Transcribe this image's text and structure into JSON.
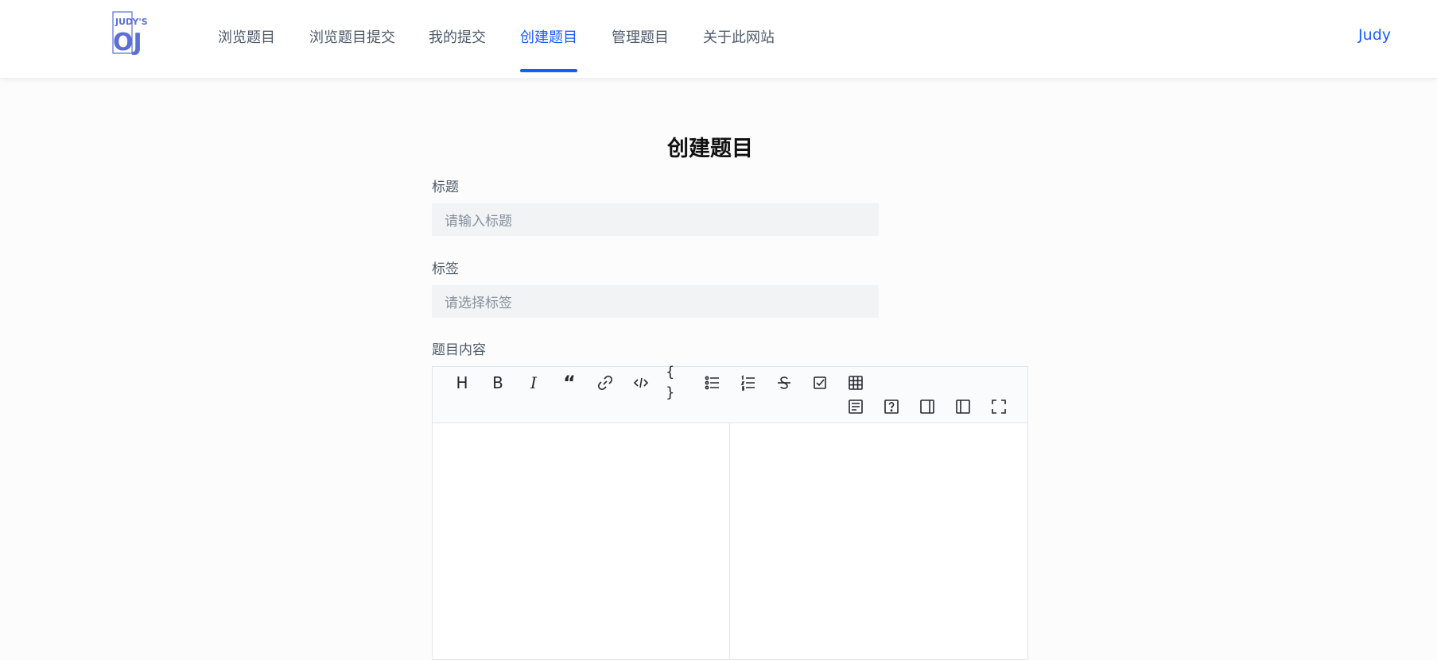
{
  "header": {
    "logo_text_top": "JUDY'S",
    "logo_text_main": "OJ",
    "nav": [
      {
        "label": "浏览题目",
        "active": false
      },
      {
        "label": "浏览题目提交",
        "active": false
      },
      {
        "label": "我的提交",
        "active": false
      },
      {
        "label": "创建题目",
        "active": true
      },
      {
        "label": "管理题目",
        "active": false
      },
      {
        "label": "关于此网站",
        "active": false
      }
    ],
    "user": "Judy"
  },
  "form": {
    "title": "创建题目",
    "title_label": "标题",
    "title_placeholder": "请输入标题",
    "tags_label": "标签",
    "tags_placeholder": "请选择标签",
    "content_label": "题目内容"
  },
  "editor": {
    "toolbar_row1": [
      "heading-icon",
      "bold-icon",
      "italic-icon",
      "quote-icon",
      "link-icon",
      "code-icon",
      "code-block-icon",
      "unordered-list-icon",
      "ordered-list-icon",
      "strikethrough-icon",
      "task-list-icon",
      "table-icon"
    ],
    "toolbar_row2": [
      "toc-icon",
      "help-icon",
      "preview-only-icon",
      "write-only-icon",
      "fullscreen-icon"
    ]
  },
  "colors": {
    "accent": "#165dff",
    "nav_text": "#4e5969",
    "input_bg": "#f2f3f5",
    "logo": "#5b6fd6"
  }
}
